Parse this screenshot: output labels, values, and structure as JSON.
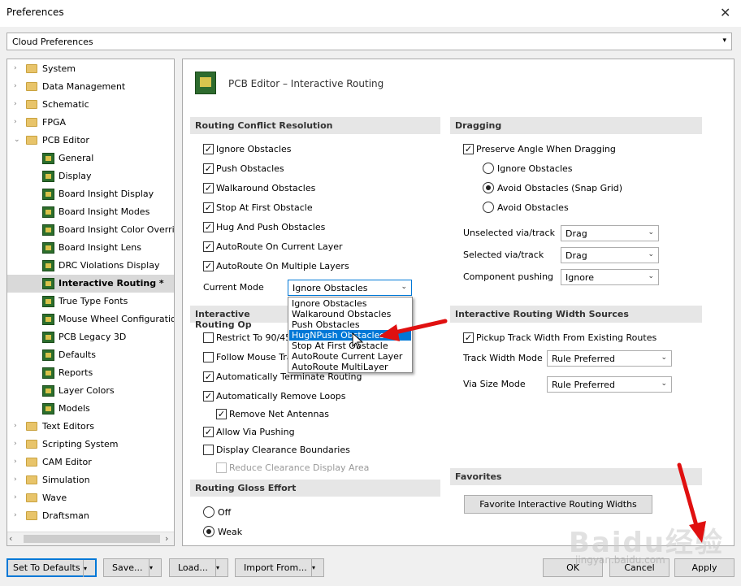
{
  "window": {
    "title": "Preferences",
    "close_glyph": "✕"
  },
  "cloud": {
    "label": "Cloud Preferences",
    "arrow": "▾"
  },
  "tree": {
    "items": [
      {
        "label": "System",
        "level": 0,
        "icon": "folder-icon",
        "expander": "›"
      },
      {
        "label": "Data Management",
        "level": 0,
        "icon": "folder-icon",
        "expander": "›"
      },
      {
        "label": "Schematic",
        "level": 0,
        "icon": "folder-icon",
        "expander": "›"
      },
      {
        "label": "FPGA",
        "level": 0,
        "icon": "folder-icon",
        "expander": "›"
      },
      {
        "label": "PCB Editor",
        "level": 0,
        "icon": "folder-icon",
        "expander": "⌄"
      },
      {
        "label": "General",
        "level": 1,
        "icon": "pcb-page-icon"
      },
      {
        "label": "Display",
        "level": 1,
        "icon": "pcb-page-icon"
      },
      {
        "label": "Board Insight Display",
        "level": 1,
        "icon": "pcb-page-icon"
      },
      {
        "label": "Board Insight Modes",
        "level": 1,
        "icon": "pcb-page-icon"
      },
      {
        "label": "Board Insight Color Overrides",
        "level": 1,
        "icon": "pcb-page-icon"
      },
      {
        "label": "Board Insight Lens",
        "level": 1,
        "icon": "pcb-page-icon"
      },
      {
        "label": "DRC Violations Display",
        "level": 1,
        "icon": "pcb-page-icon"
      },
      {
        "label": "Interactive Routing *",
        "level": 1,
        "icon": "pcb-page-icon",
        "selected": true
      },
      {
        "label": "True Type Fonts",
        "level": 1,
        "icon": "pcb-page-icon"
      },
      {
        "label": "Mouse Wheel Configuration",
        "level": 1,
        "icon": "pcb-page-icon"
      },
      {
        "label": "PCB Legacy 3D",
        "level": 1,
        "icon": "pcb-page-icon"
      },
      {
        "label": "Defaults",
        "level": 1,
        "icon": "pcb-page-icon"
      },
      {
        "label": "Reports",
        "level": 1,
        "icon": "pcb-page-icon"
      },
      {
        "label": "Layer Colors",
        "level": 1,
        "icon": "pcb-page-icon"
      },
      {
        "label": "Models",
        "level": 1,
        "icon": "pcb-page-icon"
      },
      {
        "label": "Text Editors",
        "level": 0,
        "icon": "folder-icon",
        "expander": "›"
      },
      {
        "label": "Scripting System",
        "level": 0,
        "icon": "folder-icon",
        "expander": "›"
      },
      {
        "label": "CAM Editor",
        "level": 0,
        "icon": "folder-icon",
        "expander": "›"
      },
      {
        "label": "Simulation",
        "level": 0,
        "icon": "folder-icon",
        "expander": "›"
      },
      {
        "label": "Wave",
        "level": 0,
        "icon": "folder-icon",
        "expander": "›"
      },
      {
        "label": "Draftsman",
        "level": 0,
        "icon": "folder-icon",
        "expander": "›"
      }
    ],
    "scroll_left": "‹",
    "scroll_right": "›"
  },
  "panel": {
    "title": "PCB Editor – Interactive Routing",
    "conflict": {
      "header": "Routing Conflict Resolution",
      "checks": [
        {
          "label": "Ignore Obstacles",
          "checked": true
        },
        {
          "label": "Push Obstacles",
          "checked": true
        },
        {
          "label": "Walkaround Obstacles",
          "checked": true
        },
        {
          "label": "Stop At First Obstacle",
          "checked": true
        },
        {
          "label": "Hug And Push Obstacles",
          "checked": true
        },
        {
          "label": "AutoRoute On Current Layer",
          "checked": true
        },
        {
          "label": "AutoRoute On Multiple Layers",
          "checked": true
        }
      ],
      "current_mode_label": "Current Mode",
      "current_mode_value": "Ignore Obstacles"
    },
    "dropdown": {
      "options": [
        "Ignore Obstacles",
        "Walkaround Obstacles",
        "Push Obstacles",
        "HugNPush Obstacles",
        "Stop At First Obstacle",
        "AutoRoute Current Layer",
        "AutoRoute MultiLayer"
      ],
      "highlighted_index": 3
    },
    "options_section": {
      "header": "Interactive Routing Op",
      "checks": [
        {
          "label": "Restrict To 90/45",
          "checked": false
        },
        {
          "label": "Follow Mouse Tra",
          "checked": false
        },
        {
          "label": "Automatically Terminate Routing",
          "checked": true
        },
        {
          "label": "Automatically Remove Loops",
          "checked": true
        },
        {
          "label": "Remove Net Antennas",
          "checked": true
        },
        {
          "label": "Allow Via Pushing",
          "checked": true
        },
        {
          "label": "Display Clearance Boundaries",
          "checked": false
        },
        {
          "label": "Reduce Clearance Display Area",
          "checked": false,
          "disabled": true
        }
      ]
    },
    "gloss": {
      "header": "Routing Gloss Effort",
      "radios": [
        {
          "label": "Off",
          "selected": false
        },
        {
          "label": "Weak",
          "selected": true
        }
      ]
    },
    "dragging": {
      "header": "Dragging",
      "preserve_angle": {
        "label": "Preserve Angle When Dragging",
        "checked": true
      },
      "radios": [
        {
          "label": "Ignore Obstacles",
          "selected": false
        },
        {
          "label": "Avoid Obstacles (Snap Grid)",
          "selected": true
        },
        {
          "label": "Avoid Obstacles",
          "selected": false
        }
      ],
      "rows": [
        {
          "label": "Unselected via/track",
          "value": "Drag"
        },
        {
          "label": "Selected via/track",
          "value": "Drag"
        },
        {
          "label": "Component pushing",
          "value": "Ignore"
        }
      ]
    },
    "width_sources": {
      "header": "Interactive Routing Width Sources",
      "pickup": {
        "label": "Pickup Track Width From Existing Routes",
        "checked": true
      },
      "rows": [
        {
          "label": "Track Width Mode",
          "value": "Rule Preferred"
        },
        {
          "label": "Via Size Mode",
          "value": "Rule Preferred"
        }
      ]
    },
    "favorites": {
      "header": "Favorites",
      "button": "Favorite Interactive Routing Widths"
    }
  },
  "footer": {
    "set_defaults": "Set To Defaults",
    "save": "Save...",
    "load": "Load...",
    "import_from": "Import From...",
    "ok": "OK",
    "cancel": "Cancel",
    "apply": "Apply",
    "split_arrow": "▾"
  },
  "watermark": {
    "logo": "Baidu经验",
    "url": "jingyan.baidu.com"
  },
  "colors": {
    "accent": "#0078d7",
    "arrow": "#e01010",
    "section_bg": "#e6e6e6"
  }
}
